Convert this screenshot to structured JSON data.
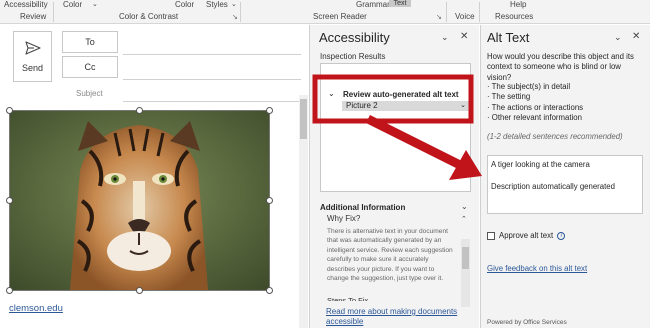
{
  "ribbon": {
    "top_items": [
      "Accessibility",
      "Color",
      "Color",
      "Styles",
      "Grammar",
      "Text",
      "Help"
    ],
    "groups": [
      "Review",
      "Color & Contrast",
      "Screen Reader",
      "Voice",
      "Resources"
    ]
  },
  "compose": {
    "send_label": "Send",
    "to_label": "To",
    "cc_label": "Cc",
    "subject_label": "Subject",
    "link_text": "clemson.edu"
  },
  "accessibility_pane": {
    "title": "Accessibility",
    "inspection_label": "Inspection Results",
    "review_label": "Review auto-generated alt text",
    "picture_value": "Picture 2",
    "additional_info_label": "Additional Information",
    "why_fix_label": "Why Fix?",
    "why_fix_text": "There is alternative text in your document that was automatically generated by an intelligent service. Review each suggestion carefully to make sure it accurately describes your picture. If you want to change the suggestion, just type over it.",
    "steps_label": "Steps To Fix",
    "learn_more_link": "Read more about making documents accessible"
  },
  "alt_text_pane": {
    "title": "Alt Text",
    "question": "How would you describe this object and its context to someone who is blind or low vision?",
    "bullets": [
      "The subject(s) in detail",
      "The setting",
      "The actions or interactions",
      "Other relevant information"
    ],
    "recommendation": "(1-2 detailed sentences recommended)",
    "alt_text_line1": "A tiger looking at the camera",
    "alt_text_line2": "Description automatically generated",
    "approve_label": "Approve alt text",
    "feedback_link": "Give feedback on this alt text",
    "powered_by": "Powered by Office Services"
  },
  "colors": {
    "annotation_red": "#c0141a",
    "link_blue": "#2b5797",
    "pane_bg": "#f3f3f3"
  }
}
